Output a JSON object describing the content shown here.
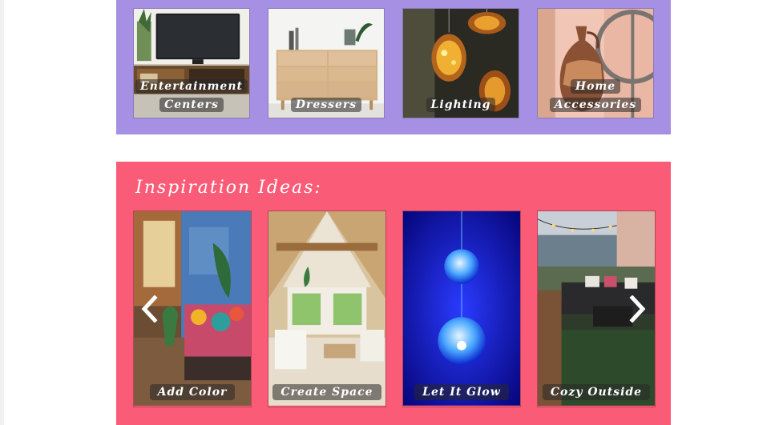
{
  "categories": [
    {
      "label_line1": "Entertainment",
      "label_line2": "Centers",
      "image_icon": "tv-stand-image"
    },
    {
      "label_line1": "Dressers",
      "label_line2": "",
      "image_icon": "dresser-image"
    },
    {
      "label_line1": "Lighting",
      "label_line2": "",
      "image_icon": "lantern-image"
    },
    {
      "label_line1": "Home",
      "label_line2": "Accessories",
      "image_icon": "vase-image"
    }
  ],
  "inspiration": {
    "title": "Inspiration Ideas:",
    "cards": [
      {
        "label": "Add Color",
        "image_icon": "colorful-room-image"
      },
      {
        "label": "Create Space",
        "image_icon": "a-frame-loft-image"
      },
      {
        "label": "Let It Glow",
        "image_icon": "glowing-orbs-image"
      },
      {
        "label": "Cozy Outside",
        "image_icon": "patio-image"
      }
    ],
    "prev_icon": "chevron-left-icon",
    "next_icon": "chevron-right-icon"
  },
  "colors": {
    "category_bg": "#a690e3",
    "inspiration_bg": "#fa5b77",
    "label_overlay": "rgba(40,40,40,0.55)"
  }
}
